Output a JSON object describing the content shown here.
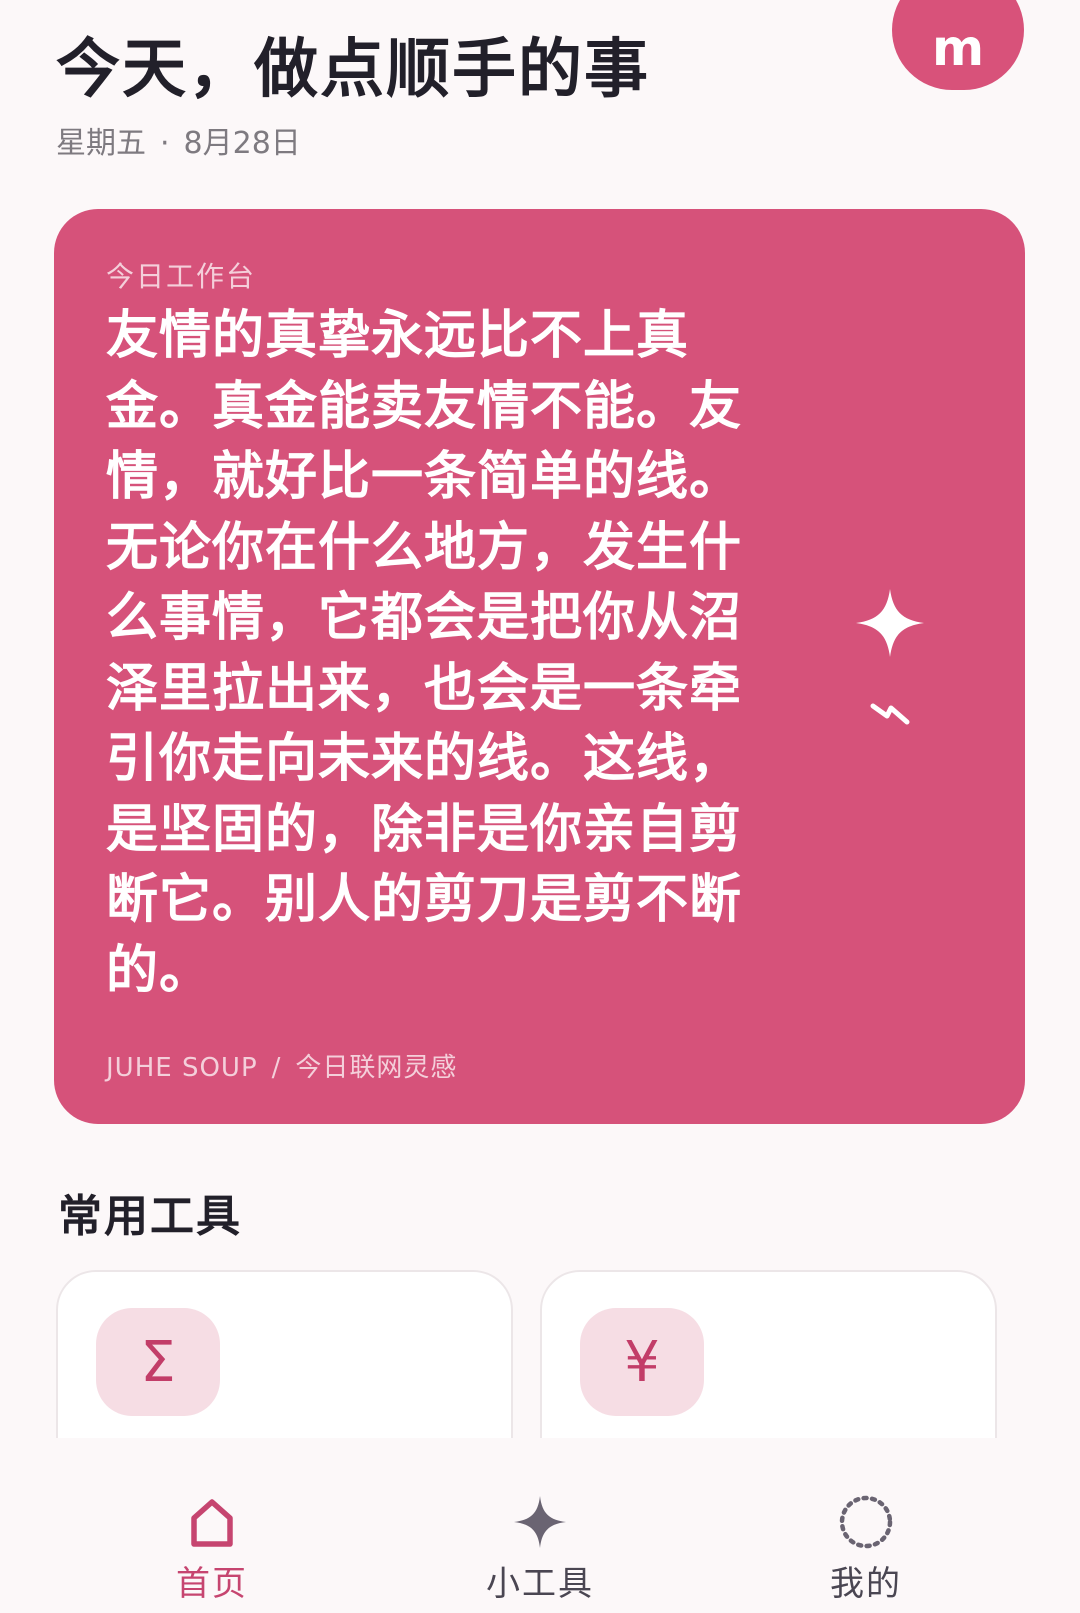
{
  "header": {
    "title": "今天，做点顺手的事",
    "avatar_letter": "m",
    "weekday": "星期五",
    "separator": "·",
    "date": "8月28日"
  },
  "hero": {
    "label": "今日工作台",
    "quote": "友情的真挚永远比不上真金。真金能卖友情不能。友情，就好比一条简单的线。无论你在什么地方，发生什么事情，它都会是把你从沼泽里拉出来，也会是一条牵引你走向未来的线。这线，是坚固的，除非是你亲自剪断它。别人的剪刀是剪不断的。",
    "source_brand": "JUHE SOUP",
    "source_slash": "/",
    "source_desc": "今日联网灵感",
    "icons": [
      "sparkle-icon",
      "bolt-icon"
    ]
  },
  "tools": {
    "title": "常用工具",
    "items": [
      {
        "icon": "sigma-icon",
        "glyph": "Σ"
      },
      {
        "icon": "yen-icon",
        "glyph": "¥"
      }
    ]
  },
  "bottom_nav": {
    "items": [
      {
        "label": "首页",
        "icon": "home-icon",
        "active": true
      },
      {
        "label": "小工具",
        "icon": "sparkle-icon",
        "active": false
      },
      {
        "label": "我的",
        "icon": "dotted-circle-icon",
        "active": false
      }
    ]
  },
  "colors": {
    "accent": "#d6527a",
    "active_nav": "#c64570",
    "background": "#fcf8f9",
    "text_primary": "#22202a",
    "icon_tile": "#f6dde4"
  }
}
